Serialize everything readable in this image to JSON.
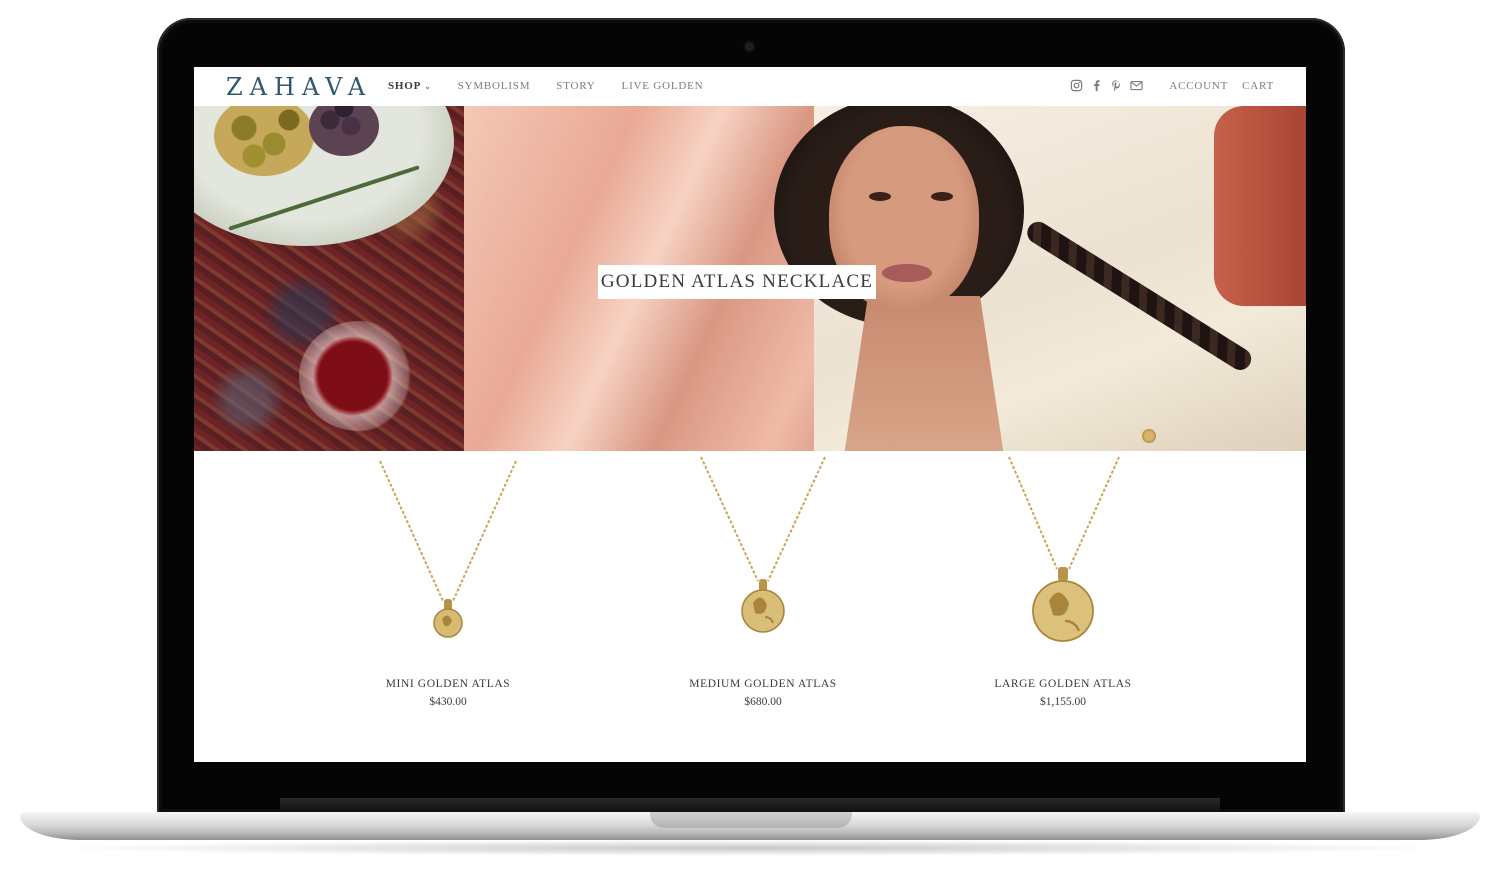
{
  "brand": {
    "logo": "ZAHAVA"
  },
  "nav": {
    "items": [
      {
        "label": "SHOP",
        "active": true,
        "has_dropdown": true
      },
      {
        "label": "SYMBOLISM",
        "active": false
      },
      {
        "label": "STORY",
        "active": false
      },
      {
        "label": "LIVE GOLDEN",
        "active": false
      }
    ],
    "social": [
      "instagram-icon",
      "facebook-icon",
      "pinterest-icon",
      "email-icon"
    ],
    "account": "ACCOUNT",
    "cart": "CART"
  },
  "hero": {
    "title": "GOLDEN ATLAS NECKLACE"
  },
  "products": [
    {
      "name": "MINI GOLDEN ATLAS",
      "price": "$430.00"
    },
    {
      "name": "MEDIUM GOLDEN ATLAS",
      "price": "$680.00"
    },
    {
      "name": "LARGE GOLDEN ATLAS",
      "price": "$1,155.00"
    }
  ],
  "colors": {
    "logo": "#2f5870",
    "nav_text": "#7c7c7c",
    "body_text": "#3a3a3a",
    "gold": "#c9a45a"
  }
}
